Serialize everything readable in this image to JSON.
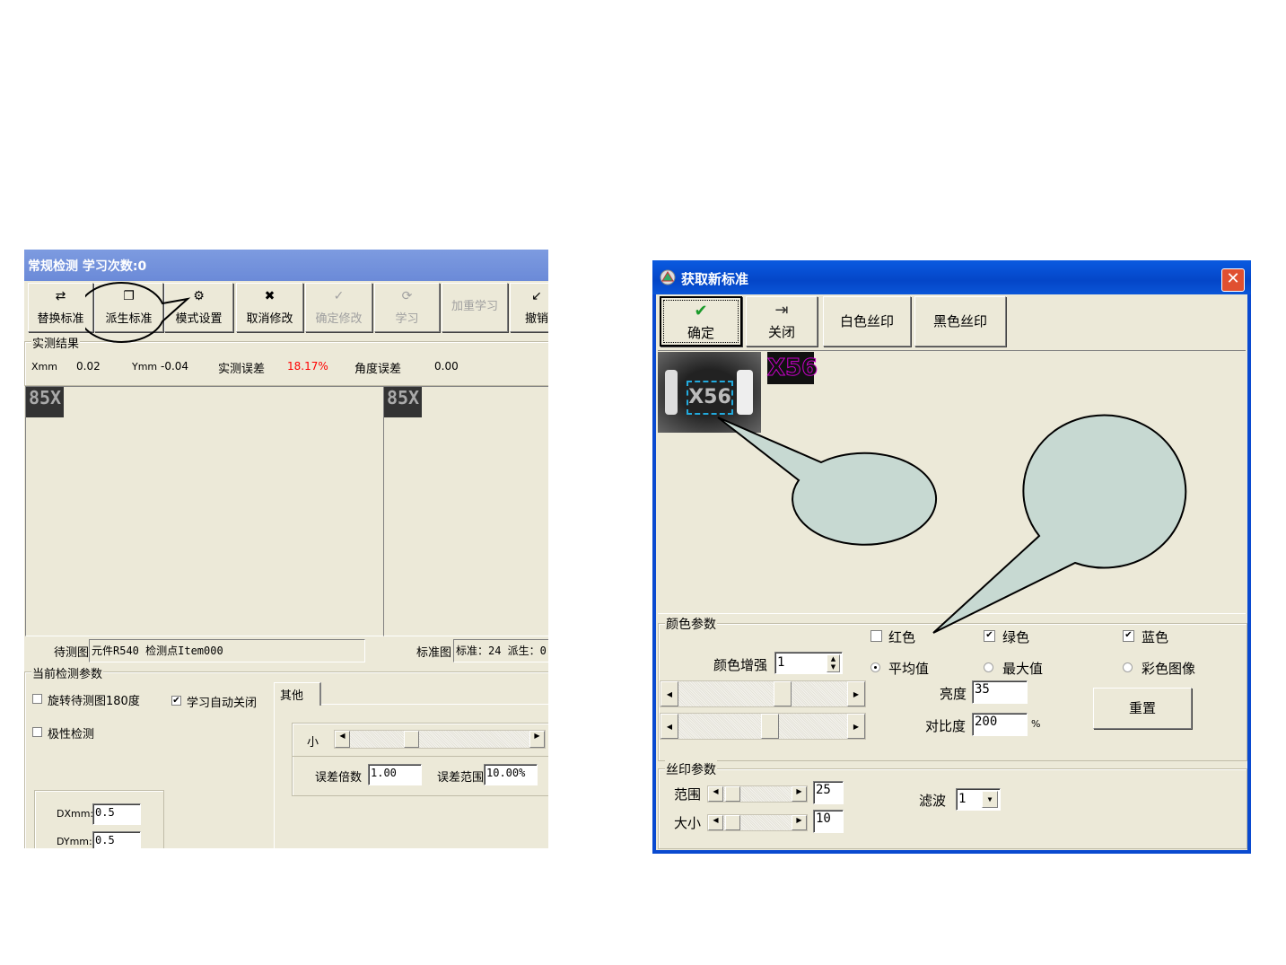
{
  "left": {
    "title": "常规检测 学习次数:0",
    "toolbar": [
      {
        "label": "替换标准",
        "icon": "replace-standard-icon",
        "enabled": true
      },
      {
        "label": "派生标准",
        "icon": "derive-standard-icon",
        "enabled": true
      },
      {
        "label": "模式设置",
        "icon": "gear-icon",
        "enabled": true
      },
      {
        "label": "取消修改",
        "icon": "cancel-edit-icon",
        "enabled": true
      },
      {
        "label": "确定修改",
        "icon": "check-icon",
        "enabled": false
      },
      {
        "label": "学习",
        "icon": "refresh-icon",
        "enabled": false
      },
      {
        "label": "加重学习",
        "enabled": false
      },
      {
        "label": "撤销",
        "icon": "undo-icon",
        "enabled": true
      }
    ],
    "results": {
      "group": "实测结果",
      "xmm_label": "Xmm",
      "xmm": "0.02",
      "ymm_label": "Ymm",
      "ymm": "-0.04",
      "err_label": "实测误差",
      "err": "18.17%",
      "angle_label": "角度误差",
      "angle": "0.00",
      "err_color": "#ff0000"
    },
    "test_image_label": "85X",
    "std_image_label": "85X",
    "info": {
      "test_label": "待测图",
      "test_value": "元件R540 检测点Item000",
      "std_label": "标准图",
      "std_value": "标准：24 派生：0"
    },
    "params": {
      "group": "当前检测参数",
      "rotate": {
        "label": "旋转待测图180度",
        "checked": false
      },
      "auto_close": {
        "label": "学习自动关闭",
        "checked": true
      },
      "polarity": {
        "label": "极性检测",
        "checked": false
      },
      "dx_label": "DXmm:",
      "dx": "0.5",
      "dy_label": "DYmm:",
      "dy": "0.5",
      "tab": "其他",
      "small_label": "小",
      "err_mult_label": "误差倍数",
      "err_mult": "1.00",
      "err_range_label": "误差范围",
      "err_range": "10.00%"
    }
  },
  "right": {
    "title": "获取新标准",
    "toolbar": [
      {
        "label": "确定",
        "icon": "check-icon"
      },
      {
        "label": "关闭",
        "icon": "exit-door-icon"
      },
      {
        "label": "白色丝印"
      },
      {
        "label": "黑色丝印"
      }
    ],
    "preview_text": "X56",
    "color": {
      "group": "颜色参数",
      "red": {
        "label": "红色",
        "checked": false
      },
      "green": {
        "label": "绿色",
        "checked": true
      },
      "blue": {
        "label": "蓝色",
        "checked": true
      },
      "enhance_label": "颜色增强",
      "enhance": "1",
      "avg": {
        "label": "平均值",
        "selected": true
      },
      "max": {
        "label": "最大值",
        "selected": false
      },
      "colorimg": {
        "label": "彩色图像",
        "selected": false
      },
      "brightness_label": "亮度",
      "brightness": "35",
      "contrast_label": "对比度",
      "contrast": "200",
      "contrast_unit": "%",
      "reset": "重置"
    },
    "silk": {
      "group": "丝印参数",
      "range_label": "范围",
      "range": "25",
      "size_label": "大小",
      "size": "10",
      "filter_label": "滤波",
      "filter": "1"
    }
  }
}
